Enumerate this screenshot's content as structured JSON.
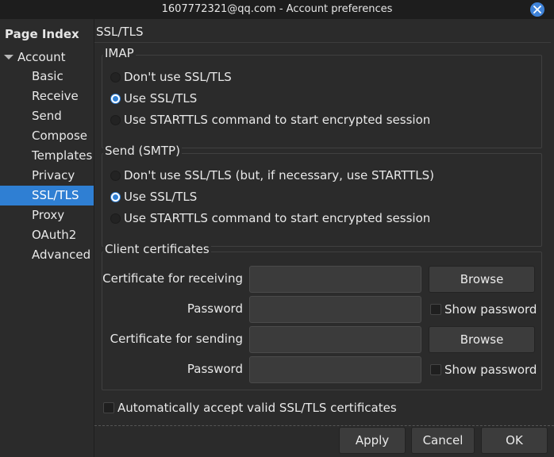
{
  "window": {
    "title": "1607772321@qq.com - Account preferences"
  },
  "sidebar": {
    "header": "Page Index",
    "root": "Account",
    "items": [
      {
        "label": "Basic",
        "active": false
      },
      {
        "label": "Receive",
        "active": false
      },
      {
        "label": "Send",
        "active": false
      },
      {
        "label": "Compose",
        "active": false
      },
      {
        "label": "Templates",
        "active": false
      },
      {
        "label": "Privacy",
        "active": false
      },
      {
        "label": "SSL/TLS",
        "active": true
      },
      {
        "label": "Proxy",
        "active": false
      },
      {
        "label": "OAuth2",
        "active": false
      },
      {
        "label": "Advanced",
        "active": false
      }
    ]
  },
  "main": {
    "section_title": "SSL/TLS",
    "imap": {
      "title": "IMAP",
      "options": [
        {
          "label": "Don't use SSL/TLS",
          "checked": false
        },
        {
          "label": "Use SSL/TLS",
          "checked": true
        },
        {
          "label": "Use STARTTLS command to start encrypted session",
          "checked": false
        }
      ]
    },
    "smtp": {
      "title": "Send (SMTP)",
      "options": [
        {
          "label": "Don't use SSL/TLS (but, if necessary, use STARTTLS)",
          "checked": false
        },
        {
          "label": "Use SSL/TLS",
          "checked": true
        },
        {
          "label": "Use STARTTLS command to start encrypted session",
          "checked": false
        }
      ]
    },
    "certs": {
      "title": "Client certificates",
      "receiving_label": "Certificate for receiving",
      "receiving_value": "",
      "password_label": "Password",
      "receiving_password": "",
      "sending_label": "Certificate for sending",
      "sending_value": "",
      "sending_password": "",
      "browse_label": "Browse",
      "show_password_label": "Show password"
    },
    "auto_accept_label": "Automatically accept valid SSL/TLS certificates"
  },
  "footer": {
    "apply": "Apply",
    "cancel": "Cancel",
    "ok": "OK"
  },
  "colors": {
    "accent": "#2f7fd3",
    "background": "#2b2b2b",
    "titlebar": "#1d1d1d"
  }
}
